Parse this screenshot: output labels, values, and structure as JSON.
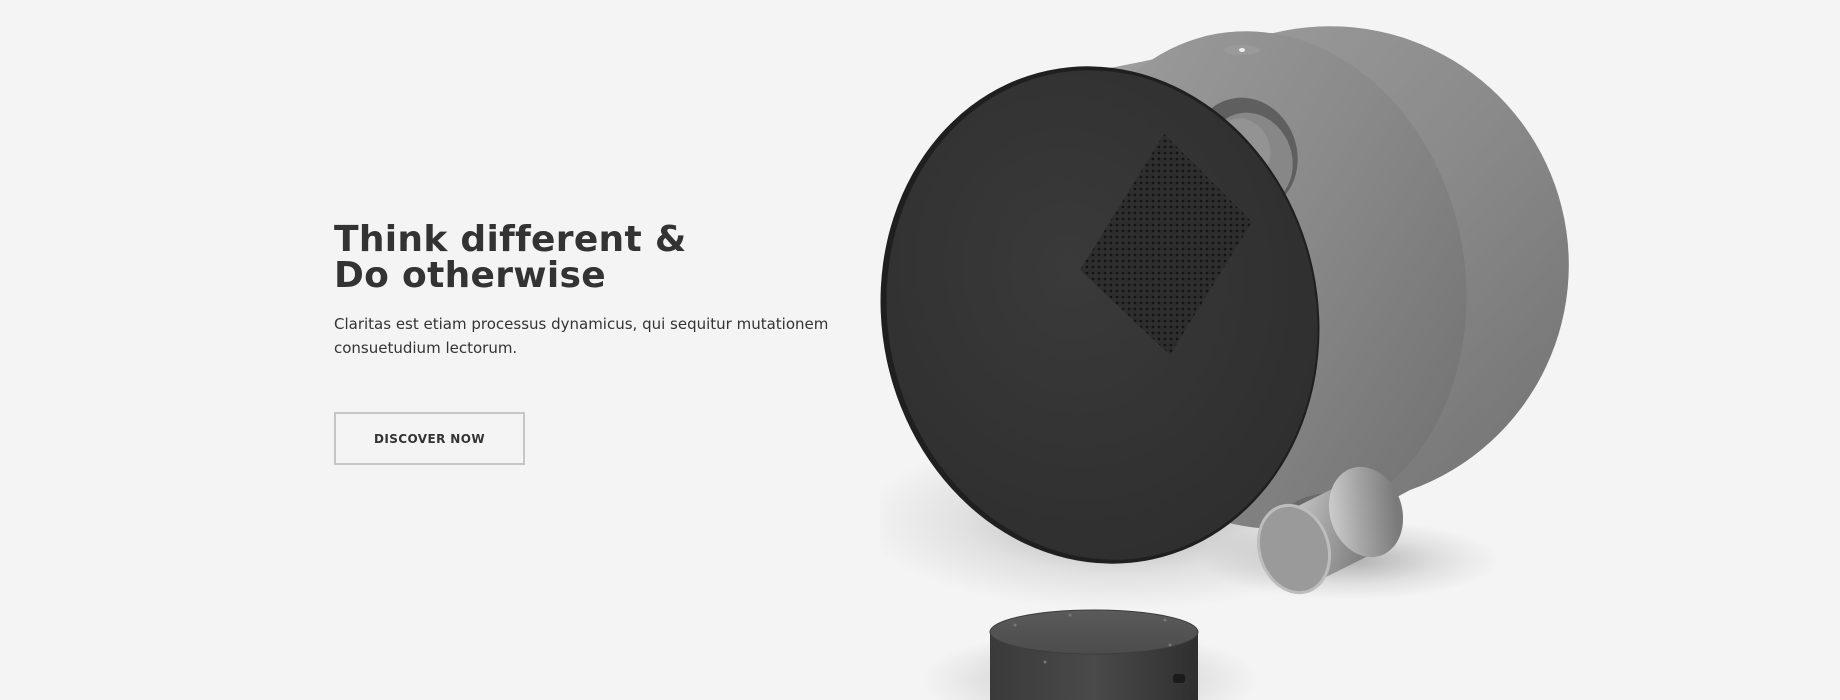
{
  "hero": {
    "title_line1": "Think different &",
    "title_line2": "Do otherwise",
    "description_line1": "Claritas est etiam processus dynamicus, qui sequitur mutationem",
    "description_line2": "consuetudium lectorum.",
    "button_label": "DISCOVER NOW"
  },
  "colors": {
    "background": "#f4f4f4",
    "text": "#333333",
    "button_border": "#c6c6c6",
    "product_face": "#343434",
    "product_shell": "#8a8a8a"
  },
  "product_image": {
    "icon": "smart-speaker-image"
  }
}
